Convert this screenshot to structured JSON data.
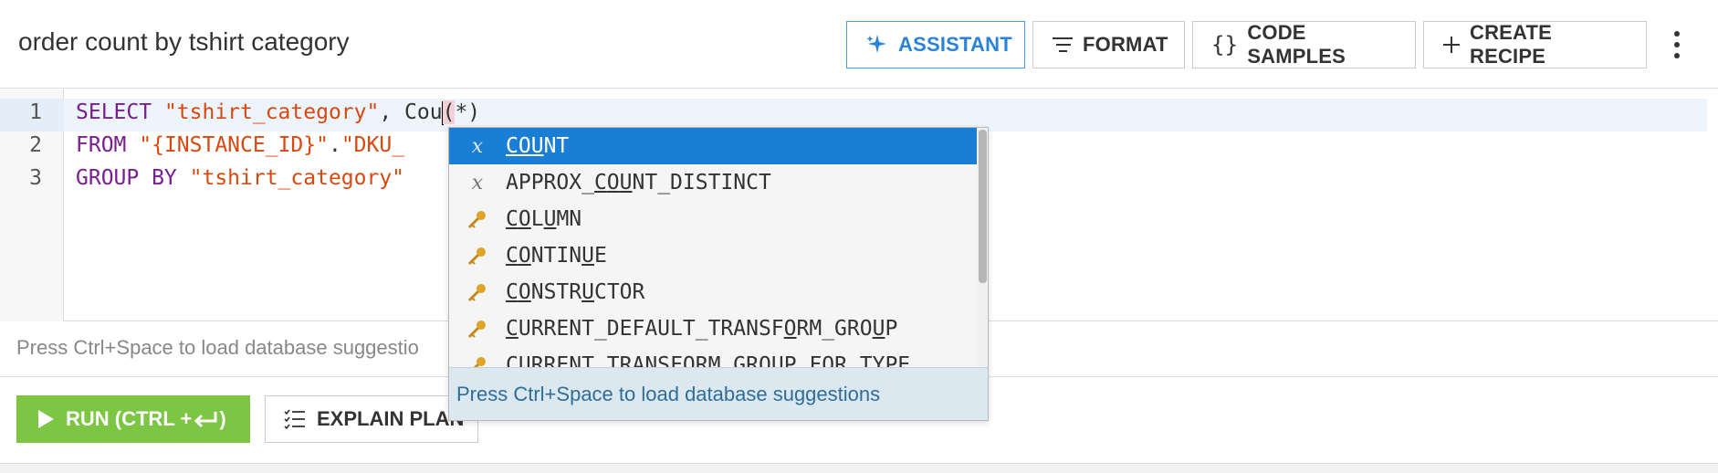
{
  "header": {
    "title": "order count by tshirt category",
    "buttons": {
      "assistant": "ASSISTANT",
      "format": "FORMAT",
      "code_samples": "CODE SAMPLES",
      "create_recipe": "CREATE RECIPE"
    }
  },
  "editor": {
    "line_numbers": [
      "1",
      "2",
      "3"
    ],
    "lines": [
      {
        "kw1": "SELECT ",
        "str1": "\"tshirt_category\"",
        "rest_before_cursor": ", Cou",
        "paren_open": "(",
        "rest_after": "*)"
      },
      {
        "kw1": "FROM ",
        "str1": "\"{INSTANCE_ID}\"",
        "dot": ".",
        "str2": "\"DKU_"
      },
      {
        "kw1": "GROUP BY ",
        "str1": "\"tshirt_category\""
      }
    ],
    "hint": "Press Ctrl+Space to load database suggestio"
  },
  "autocomplete": {
    "items": [
      {
        "type": "x",
        "label": "COUNT",
        "selected": true
      },
      {
        "type": "x",
        "label": "APPROX_COUNT_DISTINCT",
        "selected": false
      },
      {
        "type": "key",
        "label": "COLUMN",
        "selected": false
      },
      {
        "type": "key",
        "label": "CONTINUE",
        "selected": false
      },
      {
        "type": "key",
        "label": "CONSTRUCTOR",
        "selected": false
      },
      {
        "type": "key",
        "label": "CURRENT_DEFAULT_TRANSFORM_GROUP",
        "selected": false
      },
      {
        "type": "key",
        "label": "CURRENT_TRANSFORM_GROUP_FOR_TYPE",
        "selected": false
      }
    ],
    "footer": "Press Ctrl+Space to load database suggestions"
  },
  "actions": {
    "run": "RUN (CTRL + ",
    "explain": "EXPLAIN PLAN"
  },
  "colors": {
    "accent": "#2a83d9",
    "run_green": "#7cc644",
    "selection": "#1a7fd4",
    "keyword": "#7a1e8f",
    "string": "#d9480f"
  },
  "icons": {
    "assistant": "sparkle-icon",
    "format": "format-lines-icon",
    "code_samples": "braces-icon",
    "create_recipe": "plus-icon",
    "more": "kebab-menu-icon",
    "run": "play-icon",
    "enter": "enter-key-icon",
    "explain": "checklist-icon",
    "function": "function-x-icon",
    "keyword": "key-icon"
  }
}
